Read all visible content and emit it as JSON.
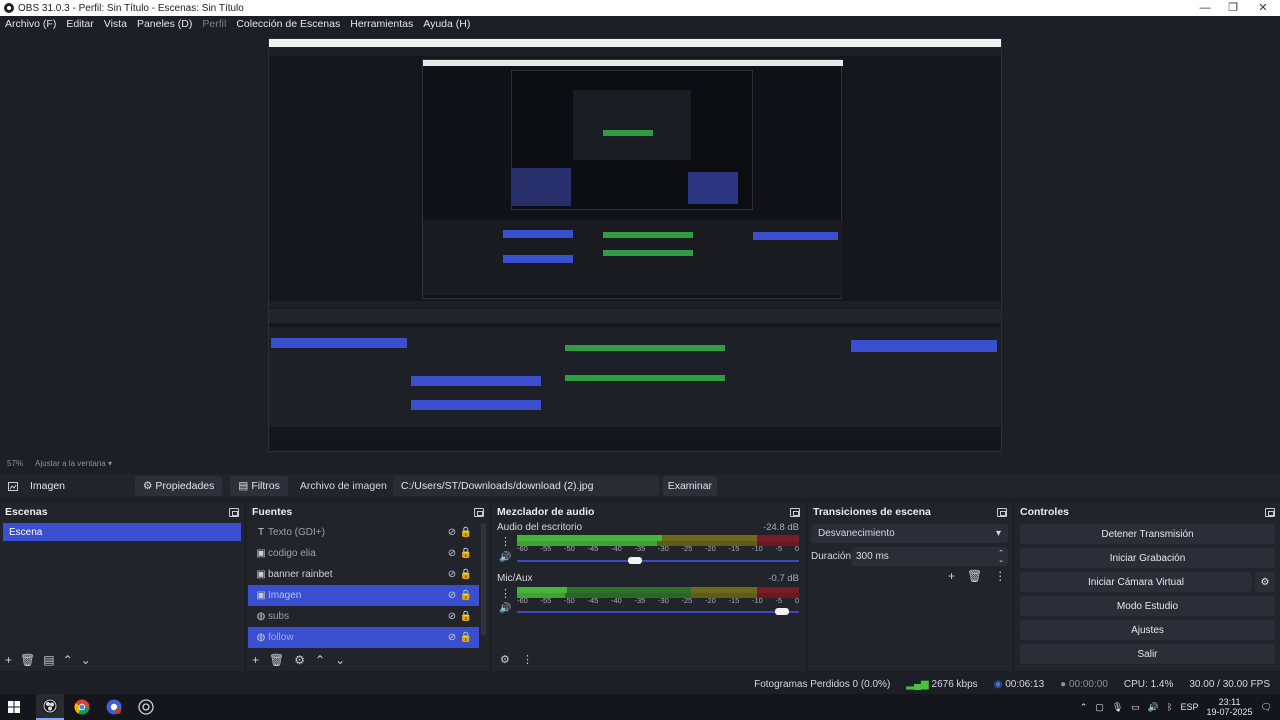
{
  "window": {
    "title": "OBS 31.0.3 - Perfil: Sin Título - Escenas: Sin Título",
    "controls": [
      "—",
      "❐",
      "✕"
    ]
  },
  "menu": [
    "Archivo (F)",
    "Editar",
    "Vista",
    "Paneles (D)",
    "Perfil",
    "Colección de Escenas",
    "Herramientas",
    "Ayuda (H)"
  ],
  "zoom": {
    "level": "57%",
    "fit": "Ajustar a la ventana"
  },
  "source_toolbar": {
    "source_name": "Imagen",
    "properties": "Propiedades",
    "filters": "Filtros",
    "file_label": "Archivo de imagen",
    "file_path": "C:/Users/ST/Downloads/download (2).jpg",
    "browse": "Examinar"
  },
  "scenes": {
    "title": "Escenas",
    "items": [
      {
        "name": "Escena",
        "selected": true
      }
    ]
  },
  "sources": {
    "title": "Fuentes",
    "items": [
      {
        "name": "Texto (GDI+)",
        "icon": "text-icon",
        "selected": false,
        "hidden": true
      },
      {
        "name": "codigo elia",
        "icon": "image-icon",
        "selected": false,
        "hidden": false
      },
      {
        "name": "banner rainbet",
        "icon": "image-icon",
        "selected": false,
        "hidden": false
      },
      {
        "name": "Imagen",
        "icon": "image-icon",
        "selected": true,
        "hidden": true
      },
      {
        "name": "subs",
        "icon": "browser-icon",
        "selected": false,
        "hidden": false
      },
      {
        "name": "follow",
        "icon": "browser-icon",
        "selected": true,
        "hidden": true
      }
    ]
  },
  "mixer": {
    "title": "Mezclador de audio",
    "channels": [
      {
        "name": "Audio del escritorio",
        "db": "-24.8 dB",
        "volume": 0.42
      },
      {
        "name": "Mic/Aux",
        "db": "-0.7 dB",
        "volume": 0.94
      }
    ],
    "scale": [
      "-60",
      "-55",
      "-50",
      "-45",
      "-40",
      "-35",
      "-30",
      "-25",
      "-20",
      "-15",
      "-10",
      "-5",
      "0"
    ]
  },
  "transitions": {
    "title": "Transiciones de escena",
    "selected": "Desvanecimiento",
    "duration_label": "Duración",
    "duration_value": "300 ms"
  },
  "controls": {
    "title": "Controles",
    "stop_stream": "Detener Transmisión",
    "start_recording": "Iniciar Grabación",
    "start_virtual_cam": "Iniciar Cámara Virtual",
    "studio_mode": "Modo Estudio",
    "settings": "Ajustes",
    "exit": "Salir"
  },
  "status": {
    "dropped_frames": "Fotogramas Perdidos 0 (0.0%)",
    "bitrate": "2676 kbps",
    "stream_time": "00:06:13",
    "rec_time": "00:00:00",
    "cpu": "CPU: 1.4%",
    "fps": "30.00 / 30.00 FPS"
  },
  "taskbar": {
    "lang": "ESP",
    "time": "23:11",
    "date": "19-07-2025"
  },
  "colors": {
    "accent": "#3a4fd0",
    "dock_bg": "#22242c",
    "app_bg": "#1d1f26"
  }
}
